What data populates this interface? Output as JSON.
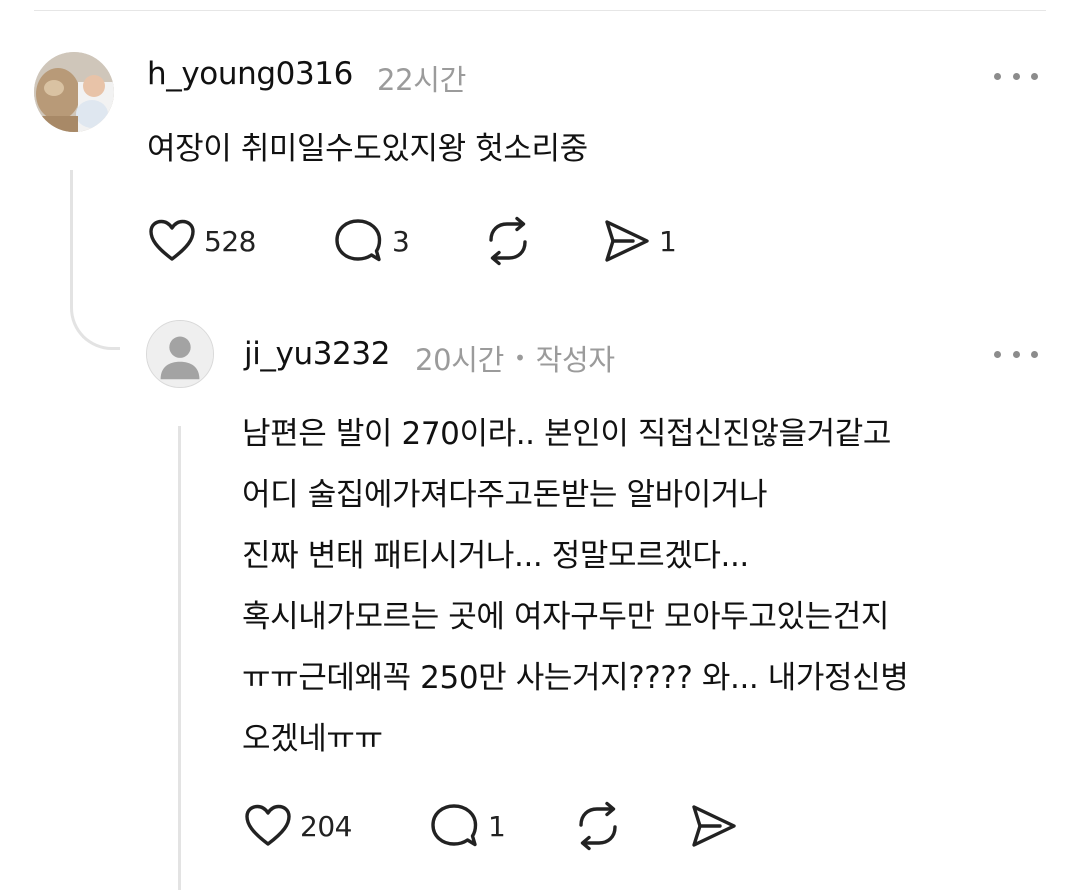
{
  "comment": {
    "username": "h_young0316",
    "time": "22시간",
    "text": "여장이 취미일수도있지왕 헛소리중",
    "likes": "528",
    "replies": "3",
    "shares": "1",
    "icons": {
      "like": "heart-icon",
      "reply": "comment-bubble-icon",
      "repost": "repost-icon",
      "share": "send-icon",
      "more": "more-icon"
    }
  },
  "reply": {
    "username": "ji_yu3232",
    "time": "20시간",
    "separator": "•",
    "author_badge": "작성자",
    "lines": [
      "남편은 발이 270이라.. 본인이 직접신진않을거같고",
      "어디 술집에가져다주고돈받는 알바이거나",
      "진짜 변태 패티시거나... 정말모르겠다...",
      "혹시내가모르는 곳에 여자구두만 모아두고있는건지",
      "ㅠㅠ근데왜꼭 250만 사는거지???? 와... 내가정신병",
      "오겠네ㅠㅠ"
    ],
    "likes": "204",
    "replies": "1",
    "icons": {
      "like": "heart-icon",
      "reply": "comment-bubble-icon",
      "repost": "repost-icon",
      "share": "send-icon",
      "more": "more-icon"
    }
  }
}
